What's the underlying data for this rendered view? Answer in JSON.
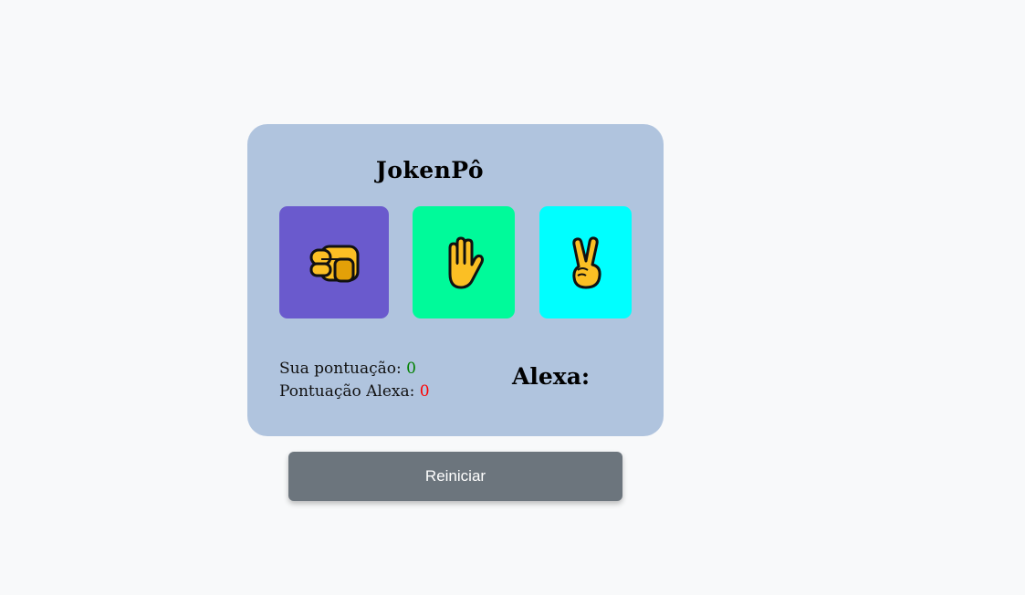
{
  "game": {
    "title": "JokenPô",
    "choices": [
      {
        "name": "rock",
        "icon": "fist-icon",
        "color": "#6a5acd"
      },
      {
        "name": "paper",
        "icon": "raised-hand-icon",
        "color": "#00fa9a"
      },
      {
        "name": "scissors",
        "icon": "victory-hand-icon",
        "color": "#00ffff"
      }
    ],
    "scores": {
      "you_label": "Sua pontuação:",
      "you_value": "0",
      "alexa_label": "Pontuação Alexa:",
      "alexa_value": "0"
    },
    "alexa_choice_label": "Alexa:",
    "restart_label": "Reiniciar"
  }
}
